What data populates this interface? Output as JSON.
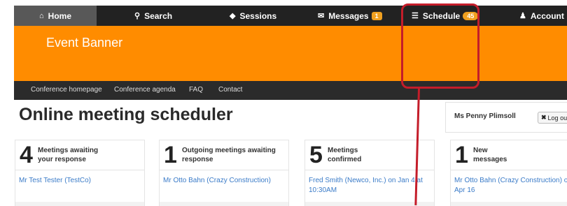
{
  "topnav": {
    "home": "Home",
    "search": "Search",
    "sessions": "Sessions",
    "messages": "Messages",
    "messages_badge": "1",
    "schedule": "Schedule",
    "schedule_badge": "45",
    "account": "Account"
  },
  "banner": {
    "title": "Event Banner"
  },
  "subnav": [
    "Conference homepage",
    "Conference agenda",
    "FAQ",
    "Contact"
  ],
  "page_title": "Online meeting scheduler",
  "user": {
    "name": "Ms Penny Plimsoll",
    "logout": "Log out"
  },
  "cards": [
    {
      "count": "4",
      "label_line1": "Meetings awaiting",
      "label_line2": "your response",
      "link": "Mr Test Tester (TestCo)"
    },
    {
      "count": "1",
      "label_line1": "Outgoing meetings awaiting",
      "label_line2": "response",
      "link": "Mr Otto Bahn (Crazy Construction)"
    },
    {
      "count": "5",
      "label_line1": "Meetings",
      "label_line2": "confirmed",
      "link": "Fred Smith (Newco, Inc.) on Jan 4 at",
      "link2": "10:30AM"
    },
    {
      "count": "1",
      "label_line1": "New",
      "label_line2": "messages",
      "link": "Mr Otto Bahn (Crazy Construction) o",
      "link2": "Apr 16"
    }
  ],
  "colors": {
    "nav": "#222222",
    "banner": "#ff8c00",
    "subnav": "#2b2b2b",
    "link": "#3a7bc8",
    "annotation": "#c41d2a",
    "badge": "#f0a020"
  }
}
